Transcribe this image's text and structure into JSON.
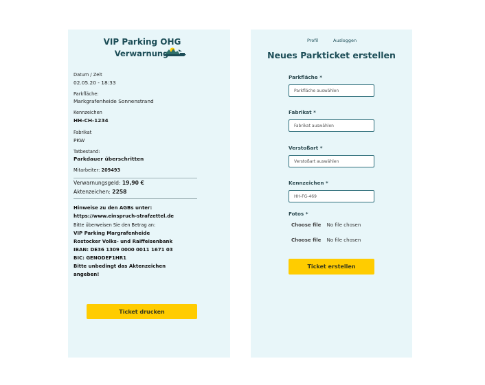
{
  "ticket": {
    "company": "VIP Parking OHG",
    "subtitle": "Verwarnung",
    "logo_icon": "parking-ship-logo-icon",
    "datum_label": "Datum / Zeit",
    "datum_value": "02.05.20 - 18:33",
    "parkflaeche_label": "Parkfläche:",
    "parkflaeche_value": "Markgrafenheide Sonnenstrand",
    "kennzeichen_label": "Kennzeichen",
    "kennzeichen_value": "HH-CH-1234",
    "fabrikat_label": "Fabrikat",
    "fabrikat_value": "PKW",
    "tatbestand_label": "Tatbestand:",
    "tatbestand_value": "Parkdauer überschritten",
    "mitarbeiter_label": "Mitarbeiter:",
    "mitarbeiter_value": "209493",
    "verwarnungsgeld_label": "Verwarnungsgeld:",
    "verwarnungsgeld_value": "19,90 €",
    "aktenzeichen_label": "Aktenzeichen:",
    "aktenzeichen_value": "2258",
    "agb_line1": "Hinweise zu den AGBs unter:",
    "agb_line2": "https://www.einspruch-strafzettel.de",
    "transfer_note": "Bitte überweisen Sie den Betrag an:",
    "bank_line1": "VIP Parking Margrafenheide",
    "bank_line2": "Rostocker Volks- und Raiffeisenbank",
    "iban": "IBAN: DE36 1309 0000 0011 1671 03",
    "bic": "BIC: GENODEF1HR1",
    "reminder_line1": "Bitte unbedingt das Aktenzeichen",
    "reminder_line2": "angeben!",
    "print_button": "Ticket drucken"
  },
  "form": {
    "nav_profile": "Profil",
    "nav_logout": "Ausloggen",
    "title": "Neues Parkticket erstellen",
    "parkflaeche_label": "Parkfläche",
    "parkflaeche_placeholder": "Parkfläche auswählen",
    "fabrikat_label": "Fabrikat",
    "fabrikat_placeholder": "Fabrikat auswählen",
    "verstoss_label": "Verstoßart",
    "verstoss_placeholder": "Verstoßart auswählen",
    "kennzeichen_label": "Kennzeichen",
    "kennzeichen_placeholder": "HH-FG-469",
    "fotos_label": "Fotos",
    "required_mark": "*",
    "file_button": "Choose file",
    "file_status": "No file chosen",
    "submit_button": "Ticket erstellen"
  },
  "colors": {
    "panel_bg": "#e8f6f9",
    "brand_teal": "#1c4d57",
    "button_yellow": "#ffcc00"
  }
}
